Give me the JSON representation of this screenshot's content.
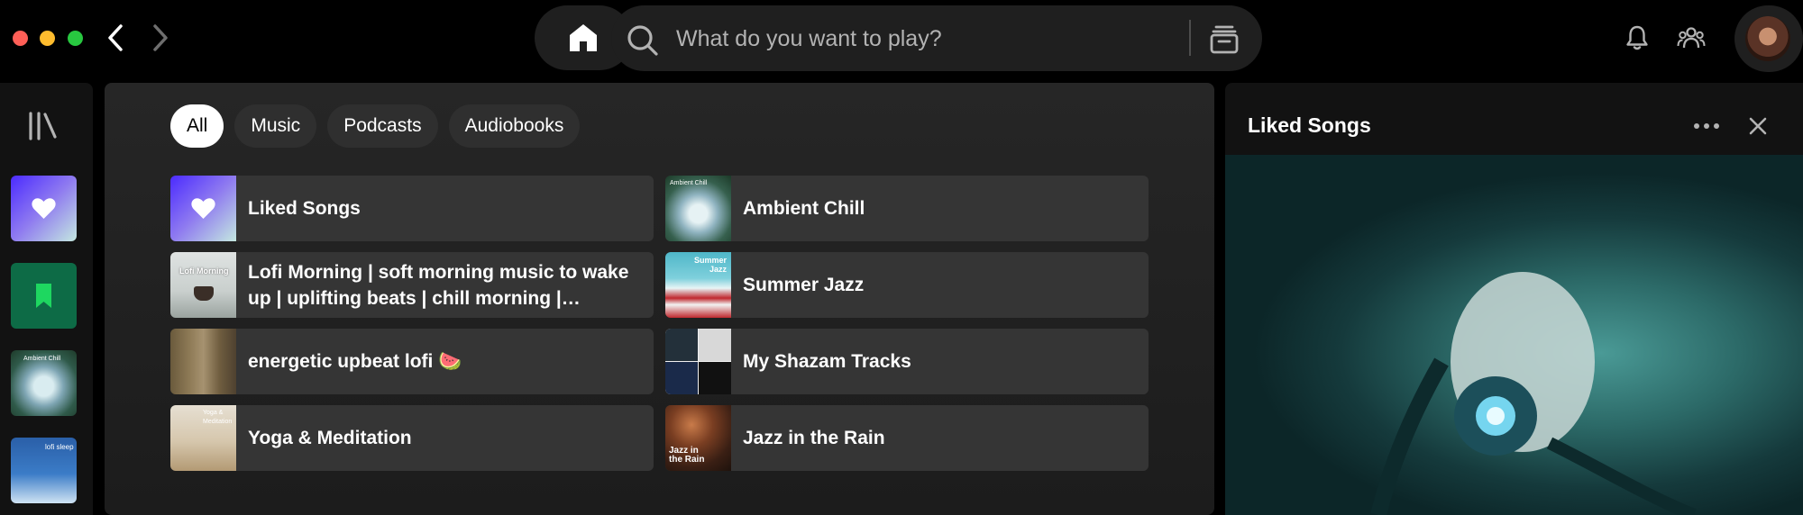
{
  "window": {
    "controls": [
      {
        "name": "close",
        "color": "#ff5f57"
      },
      {
        "name": "minimize",
        "color": "#febc2e"
      },
      {
        "name": "maximize",
        "color": "#28c840"
      }
    ]
  },
  "topbar": {
    "back_icon": "chevron-left-icon",
    "forward_icon": "chevron-right-icon",
    "home_icon": "home-icon",
    "search_placeholder": "What do you want to play?",
    "search_value": "",
    "browse_icon": "browse-icon",
    "notifications_icon": "bell-icon",
    "friends_icon": "friends-icon",
    "avatar": "user-avatar"
  },
  "sidebar": {
    "library_icon": "library-icon",
    "items": [
      {
        "name": "liked-songs",
        "icon": "heart-icon"
      },
      {
        "name": "saved-episodes",
        "icon": "bookmark-icon"
      },
      {
        "name": "ambient-chill",
        "art_text": "Ambient Chill"
      },
      {
        "name": "lofi-sleep",
        "art_text": "lofi sleep"
      }
    ]
  },
  "filters": [
    "All",
    "Music",
    "Podcasts",
    "Audiobooks"
  ],
  "active_filter": "All",
  "shortcuts": [
    {
      "title": "Liked Songs"
    },
    {
      "title": "Ambient Chill",
      "art_text": "Ambient Chill"
    },
    {
      "title": "Lofi Morning | soft morning music to wake up | uplifting beats | chill morning | relaxing...",
      "art_text": "Lofi Morning"
    },
    {
      "title": "Summer Jazz",
      "art_text": "Summer Jazz"
    },
    {
      "title": "energetic upbeat lofi 🍉"
    },
    {
      "title": "My Shazam Tracks"
    },
    {
      "title": "Yoga & Meditation",
      "art_text": "Yoga & Meditation"
    },
    {
      "title": "Jazz in the Rain",
      "art_text": "Jazz in the Rain"
    }
  ],
  "now_playing_panel": {
    "title": "Liked Songs",
    "more_icon": "more-icon",
    "close_icon": "close-icon"
  },
  "colors": {
    "background": "#000000",
    "surface": "#121212",
    "card": "#353535",
    "chip": "#2f2f2f",
    "chip_active": "#ffffff",
    "liked_gradient_start": "#4b2bff",
    "liked_gradient_end": "#c4e8e0",
    "bookmark_bg": "#0d6b46",
    "bookmark_icon": "#1ed760"
  }
}
